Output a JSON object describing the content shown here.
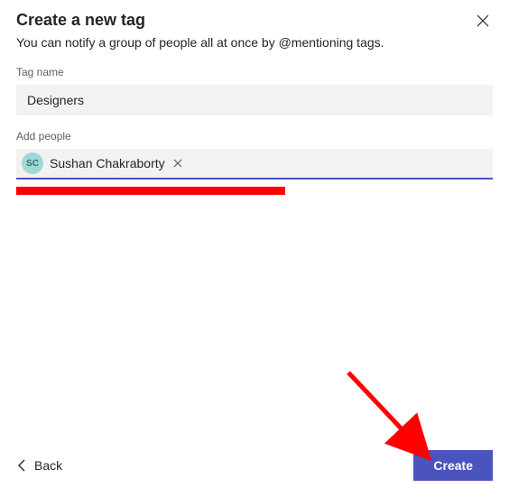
{
  "dialog": {
    "title": "Create a new tag",
    "subtitle": "You can notify a group of people all at once by @mentioning tags."
  },
  "fields": {
    "tag_name_label": "Tag name",
    "tag_name_value": "Designers",
    "add_people_label": "Add people"
  },
  "people": {
    "person1": {
      "initials": "SC",
      "name": "Sushan Chakraborty"
    }
  },
  "footer": {
    "back_label": "Back",
    "create_label": "Create"
  }
}
